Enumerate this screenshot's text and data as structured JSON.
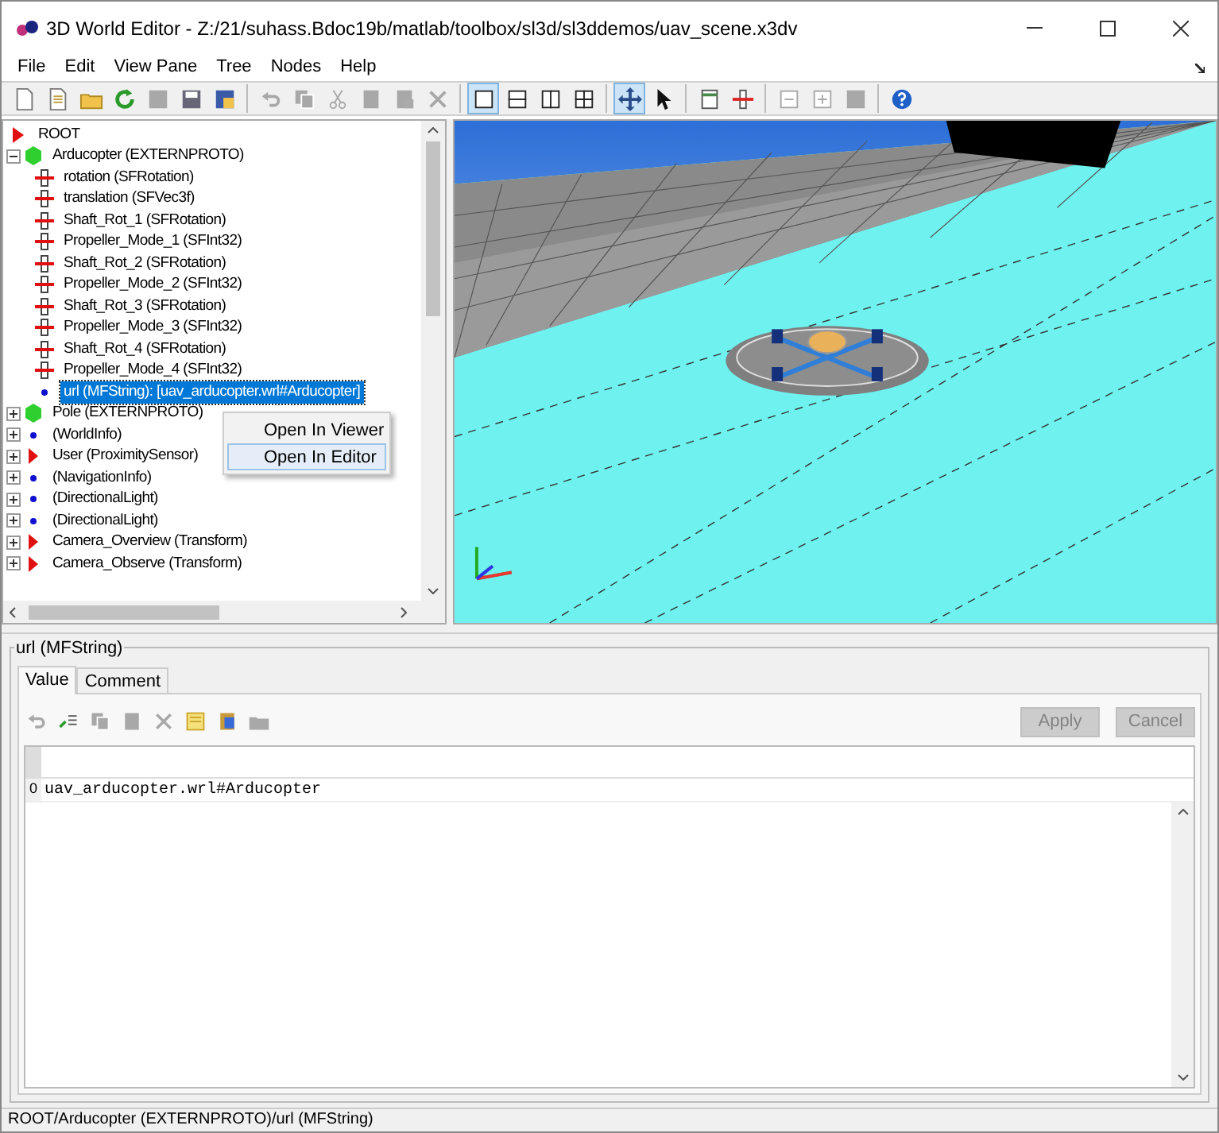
{
  "window": {
    "title": "3D World Editor - Z:/21/suhass.Bdoc19b/matlab/toolbox/sl3d/sl3ddemos/uav_scene.x3dv"
  },
  "menu": [
    "File",
    "Edit",
    "View Pane",
    "Tree",
    "Nodes",
    "Help"
  ],
  "toolbar": [
    {
      "kind": "new",
      "disabled": false,
      "pressed": false
    },
    {
      "kind": "new-doc",
      "disabled": false,
      "pressed": false
    },
    {
      "kind": "open",
      "disabled": false,
      "pressed": false
    },
    {
      "kind": "reload",
      "disabled": false,
      "pressed": false
    },
    {
      "kind": "save",
      "disabled": true,
      "pressed": false
    },
    {
      "kind": "save-as",
      "disabled": false,
      "pressed": false
    },
    {
      "kind": "export",
      "disabled": false,
      "pressed": false
    },
    {
      "kind": "separator"
    },
    {
      "kind": "undo",
      "disabled": true,
      "pressed": false
    },
    {
      "kind": "copy",
      "disabled": true,
      "pressed": false
    },
    {
      "kind": "cut",
      "disabled": true,
      "pressed": false
    },
    {
      "kind": "paste",
      "disabled": true,
      "pressed": false
    },
    {
      "kind": "paste-special",
      "disabled": true,
      "pressed": false
    },
    {
      "kind": "delete",
      "disabled": true,
      "pressed": false
    },
    {
      "kind": "separator"
    },
    {
      "kind": "pane-single",
      "disabled": false,
      "pressed": true
    },
    {
      "kind": "pane-rows",
      "disabled": false,
      "pressed": false
    },
    {
      "kind": "pane-cols",
      "disabled": false,
      "pressed": false
    },
    {
      "kind": "pane-quad",
      "disabled": false,
      "pressed": false
    },
    {
      "kind": "separator"
    },
    {
      "kind": "navigate",
      "disabled": false,
      "pressed": true
    },
    {
      "kind": "pointer",
      "disabled": false,
      "pressed": false
    },
    {
      "kind": "separator"
    },
    {
      "kind": "panel",
      "disabled": false,
      "pressed": false
    },
    {
      "kind": "field",
      "disabled": false,
      "pressed": false
    },
    {
      "kind": "separator"
    },
    {
      "kind": "minus",
      "disabled": true,
      "pressed": false
    },
    {
      "kind": "plus",
      "disabled": true,
      "pressed": false
    },
    {
      "kind": "square",
      "disabled": true,
      "pressed": false
    },
    {
      "kind": "separator"
    },
    {
      "kind": "help",
      "disabled": false,
      "pressed": false
    }
  ],
  "tree": {
    "label": "ROOT",
    "kind": "root",
    "children": [
      {
        "label": "Arducopter (EXTERNPROTO)",
        "kind": "proto",
        "expanded": true,
        "selected": false,
        "children": [
          {
            "label": "rotation (SFRotation)",
            "kind": "field",
            "selected": false
          },
          {
            "label": "translation (SFVec3f)",
            "kind": "field",
            "selected": false
          },
          {
            "label": "Shaft_Rot_1 (SFRotation)",
            "kind": "field",
            "selected": false
          },
          {
            "label": "Propeller_Mode_1 (SFInt32)",
            "kind": "field",
            "selected": false
          },
          {
            "label": "Shaft_Rot_2 (SFRotation)",
            "kind": "field",
            "selected": false
          },
          {
            "label": "Propeller_Mode_2 (SFInt32)",
            "kind": "field",
            "selected": false
          },
          {
            "label": "Shaft_Rot_3 (SFRotation)",
            "kind": "field",
            "selected": false
          },
          {
            "label": "Propeller_Mode_3 (SFInt32)",
            "kind": "field",
            "selected": false
          },
          {
            "label": "Shaft_Rot_4 (SFRotation)",
            "kind": "field",
            "selected": false
          },
          {
            "label": "Propeller_Mode_4 (SFInt32)",
            "kind": "field",
            "selected": false
          },
          {
            "label": "url (MFString): [uav_arducopter.wrl#Arducopter]",
            "kind": "value",
            "selected": true
          }
        ]
      },
      {
        "label": "Pole (EXTERNPROTO)",
        "kind": "proto",
        "expanded": false,
        "selected": false
      },
      {
        "label": "(WorldInfo)",
        "kind": "dot",
        "expanded": false,
        "selected": false
      },
      {
        "label": "User (ProximitySensor)",
        "kind": "arrow",
        "expanded": false,
        "selected": false
      },
      {
        "label": "(NavigationInfo)",
        "kind": "dot",
        "expanded": false,
        "selected": false
      },
      {
        "label": "(DirectionalLight)",
        "kind": "dot",
        "expanded": false,
        "selected": false
      },
      {
        "label": "(DirectionalLight)",
        "kind": "dot",
        "expanded": false,
        "selected": false
      },
      {
        "label": "Camera_Overview (Transform)",
        "kind": "arrow",
        "expanded": false,
        "selected": false
      },
      {
        "label": "Camera_Observe (Transform)",
        "kind": "arrow",
        "expanded": false,
        "selected": false
      }
    ]
  },
  "context_menu": [
    {
      "label": "Open In Viewer",
      "selected": false
    },
    {
      "label": "Open In Editor",
      "selected": true
    }
  ],
  "field_panel": {
    "title": "url (MFString)",
    "tabs": [
      {
        "label": "Value",
        "selected": true
      },
      {
        "label": "Comment",
        "selected": false
      }
    ],
    "toolbar": [
      {
        "kind": "undo",
        "disabled": true
      },
      {
        "kind": "add-row",
        "disabled": false
      },
      {
        "kind": "copy",
        "disabled": true
      },
      {
        "kind": "paste",
        "disabled": true
      },
      {
        "kind": "delete",
        "disabled": true
      },
      {
        "kind": "select-all",
        "disabled": false
      },
      {
        "kind": "paste-color",
        "disabled": false
      },
      {
        "kind": "folder",
        "disabled": true
      }
    ],
    "buttons": [
      {
        "label": "Apply",
        "disabled": true
      },
      {
        "label": "Cancel",
        "disabled": true
      }
    ],
    "rows": [
      {
        "index": "0",
        "value": "uav_arducopter.wrl#Arducopter"
      }
    ]
  },
  "status_bar": "ROOT/Arducopter (EXTERNPROTO)/url (MFString)"
}
